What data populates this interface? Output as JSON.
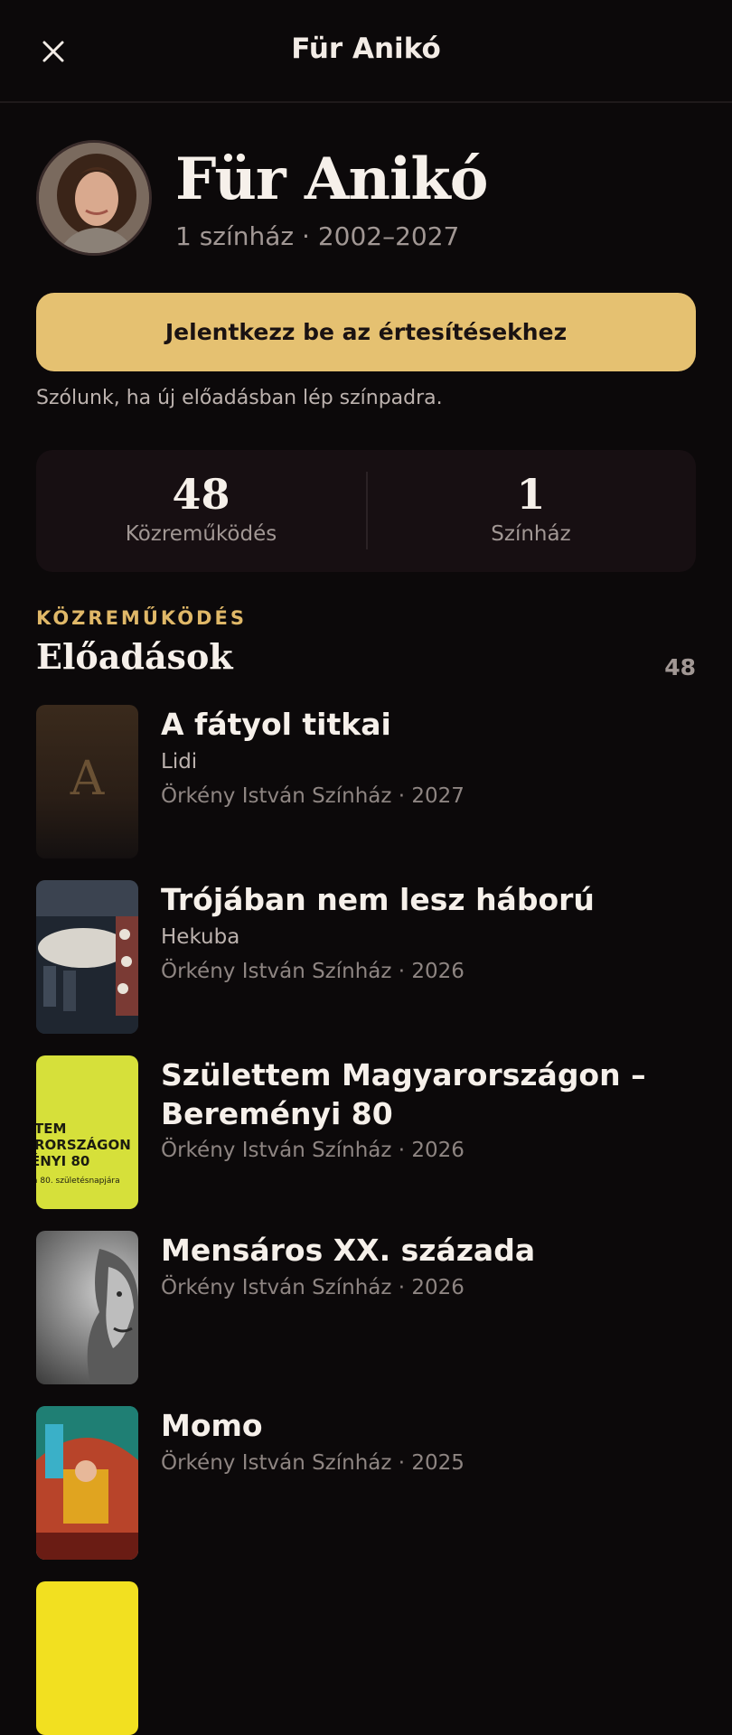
{
  "header": {
    "title": "Für Anikó"
  },
  "profile": {
    "name": "Für Anikó",
    "meta": "1 színház · 2002–2027"
  },
  "notify": {
    "button_label": "Jelentkezz be az értesítésekhez",
    "hint": "Szólunk, ha új előadásban lép színpadra."
  },
  "stats": [
    {
      "value": "48",
      "label": "Közreműködés"
    },
    {
      "value": "1",
      "label": "Színház"
    }
  ],
  "section": {
    "eyebrow": "KÖZREMŰKÖDÉS",
    "title": "Előadások",
    "count": "48"
  },
  "performances": [
    {
      "title": "A fátyol titkai",
      "role": "Lidi",
      "venue": "Örkény István Színház · 2027",
      "thumb_letter": "A"
    },
    {
      "title": "Trójában nem lesz háború",
      "role": "Hekuba",
      "venue": "Örkény István Színház · 2026"
    },
    {
      "title": "Születtem Magyarországon – Bereményi 80",
      "venue": "Örkény István Színház · 2026",
      "thumb_text_1": "TEM",
      "thumb_text_2": "RORSZÁGON",
      "thumb_text_3": "ÉNYI 80",
      "thumb_text_4": "a 80. születésnapjára"
    },
    {
      "title": "Mensáros XX. százada",
      "venue": "Örkény István Színház · 2026"
    },
    {
      "title": "Momo",
      "venue": "Örkény István Színház · 2025"
    }
  ],
  "colors": {
    "accent": "#e5c171",
    "background": "#0c090a",
    "card": "#170f12"
  },
  "icons": {
    "close": "close-icon"
  }
}
